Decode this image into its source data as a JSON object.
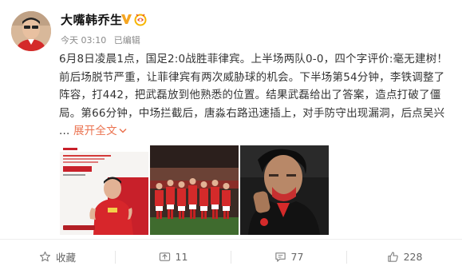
{
  "post": {
    "author": "大嘴韩乔生",
    "time": "今天 03:10",
    "edited": "已编辑",
    "lines": [
      "6月8日凌晨1点，国足2:0战胜菲律宾。上半场两队0-0，四个字评价:毫无建树！",
      "前后场脱节严重，让菲律宾有两次威胁球的机会。下半场第54分钟，李铁调整了",
      "阵容，打442，把武磊放到他熟悉的位置。结果武磊给出了答案，造点打破了僵",
      "局。第66分钟，中场拦截后，唐淼右路迅速插上，对手防守出现漏洞，后点吴兴"
    ],
    "ellipsis": "...",
    "expand_label": "展开全文"
  },
  "images": [
    {
      "name": "promo-poster-image"
    },
    {
      "name": "team-photo-image"
    },
    {
      "name": "coach-photo-image"
    }
  ],
  "actions": {
    "favorite": {
      "label": "收藏",
      "icon": "star-icon"
    },
    "repost": {
      "label": "11",
      "icon": "repost-icon"
    },
    "comment": {
      "label": "77",
      "icon": "comment-icon"
    },
    "like": {
      "label": "228",
      "icon": "thumbs-up-icon"
    }
  },
  "colors": {
    "expand": "#eb7350",
    "verified": "#f5a623"
  }
}
